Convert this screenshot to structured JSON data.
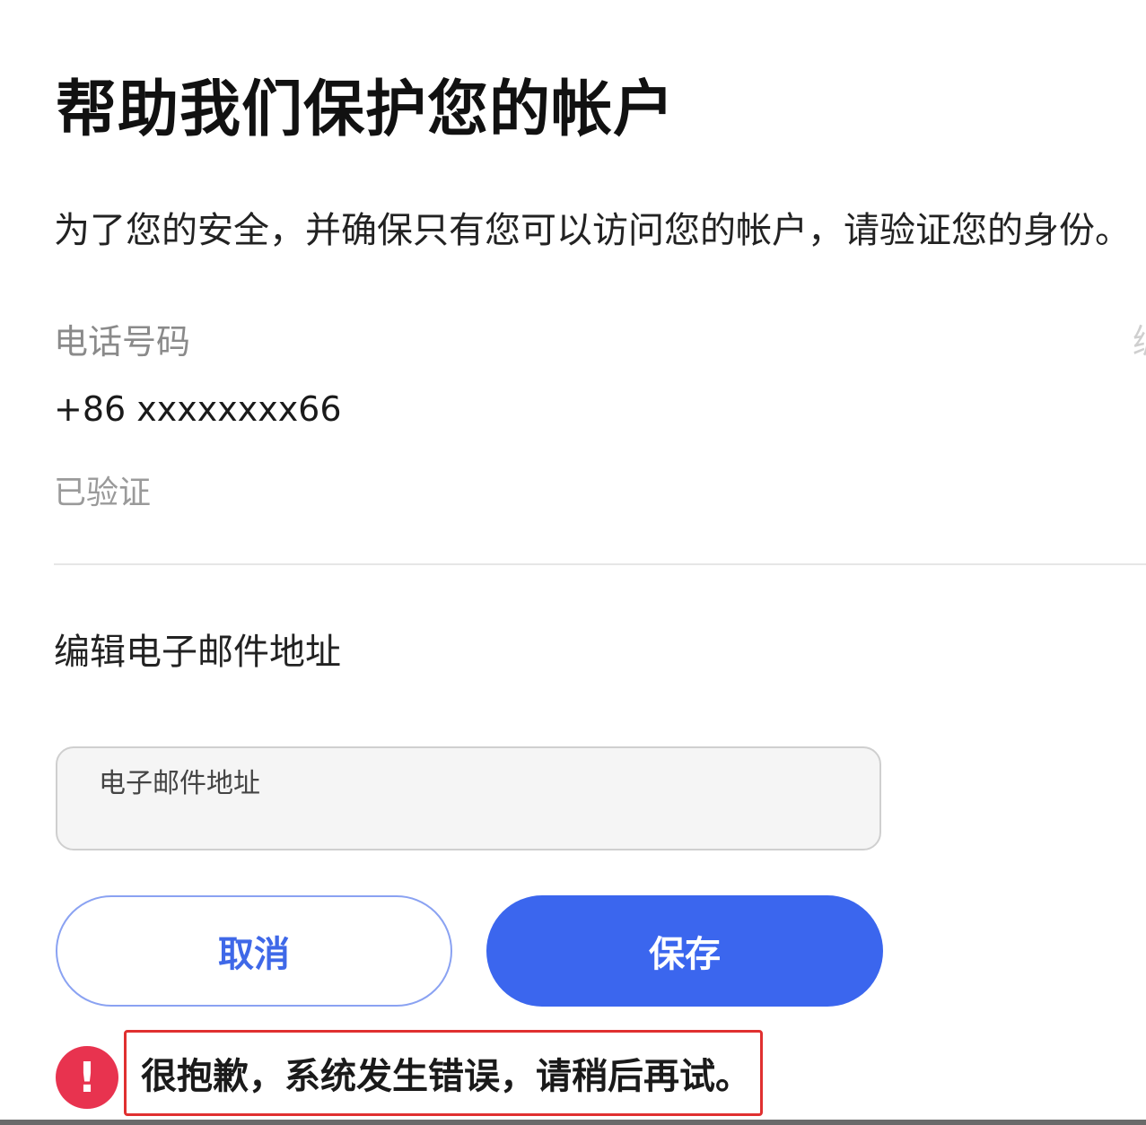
{
  "header": {
    "title": "帮助我们保护您的帐户",
    "subtitle": "为了您的安全，并确保只有您可以访问您的帐户，请验证您的身份。"
  },
  "phone": {
    "label": "电话号码",
    "value": "+86 xxxxxxxx66",
    "status": "已验证",
    "edge_text": "编"
  },
  "email_edit": {
    "heading": "编辑电子邮件地址",
    "field_label": "电子邮件地址",
    "value": ""
  },
  "actions": {
    "cancel_label": "取消",
    "save_label": "保存"
  },
  "error": {
    "icon_glyph": "!",
    "message": "很抱歉，系统发生错误，请稍后再试。"
  },
  "colors": {
    "primary": "#3b66ee",
    "cancel_border": "#8aa2f2",
    "error_red": "#e8334f",
    "highlight_box": "#e03030"
  },
  "icons": {
    "error": "exclamation-circle-icon"
  }
}
